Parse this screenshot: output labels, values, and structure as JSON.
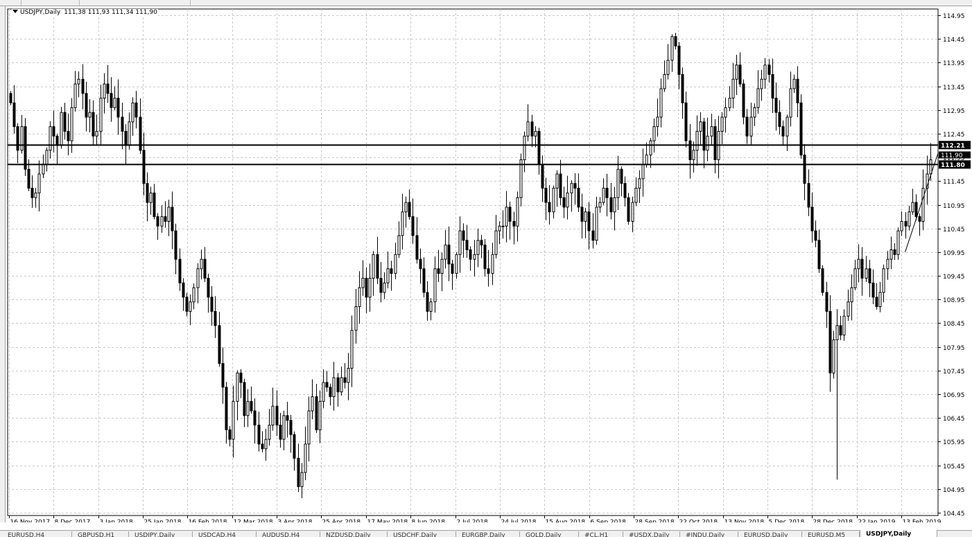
{
  "symbol": {
    "name": "USDJPY,Daily",
    "ohlc": "111,38 111,93 111,34 111,90"
  },
  "tabs": [
    {
      "label": "EURUSD,H4",
      "active": false
    },
    {
      "label": "GBPUSD,H1",
      "active": false
    },
    {
      "label": "USDJPY,Daily",
      "active": false
    },
    {
      "label": "USDCAD,H4",
      "active": false
    },
    {
      "label": "AUDUSD,H4",
      "active": false
    },
    {
      "label": "NZDUSD,Daily",
      "active": false
    },
    {
      "label": "USDCHF,Daily",
      "active": false
    },
    {
      "label": "EURGBP,Daily",
      "active": false
    },
    {
      "label": "GOLD,Daily",
      "active": false
    },
    {
      "label": "#CL,H1",
      "active": false
    },
    {
      "label": "#USDX,Daily",
      "active": false
    },
    {
      "label": "#INDU,Daily",
      "active": false
    },
    {
      "label": "EURUSD,Daily",
      "active": false
    },
    {
      "label": "EURUSD,M5",
      "active": false
    },
    {
      "label": "USDJPY,Daily",
      "active": true
    }
  ],
  "chart_data": {
    "type": "candlestick",
    "symbol": "USDJPY",
    "timeframe": "Daily",
    "y_ticks": [
      "114.95",
      "114.45",
      "113.95",
      "113.45",
      "112.95",
      "112.45",
      "111.95",
      "111.45",
      "110.95",
      "110.45",
      "109.95",
      "109.45",
      "108.95",
      "108.45",
      "107.95",
      "107.45",
      "106.95",
      "106.45",
      "105.95",
      "105.45",
      "104.95",
      "104.45"
    ],
    "ylim": [
      104.45,
      114.95
    ],
    "x_ticks": [
      "16 Nov 2017",
      "8 Dec 2017",
      "3 Jan 2018",
      "25 Jan 2018",
      "16 Feb 2018",
      "12 Mar 2018",
      "3 Apr 2018",
      "25 Apr 2018",
      "17 May 2018",
      "8 Jun 2018",
      "2 Jul 2018",
      "24 Jul 2018",
      "15 Aug 2018",
      "6 Sep 2018",
      "28 Sep 2018",
      "22 Oct 2018",
      "13 Nov 2018",
      "5 Dec 2018",
      "28 Dec 2018",
      "22 Jan 2019",
      "13 Feb 2019"
    ],
    "grid": true,
    "horizontal_lines": [
      {
        "value": 112.21,
        "label": "112.21"
      },
      {
        "value": 111.8,
        "label": "111.80"
      }
    ],
    "price_label": {
      "value": 111.9,
      "label": "111.90"
    },
    "trendline": {
      "from_date": "2019-01-03",
      "from_value": 109.95,
      "to_date": "2019-03-01",
      "to_value": 111.95
    },
    "closes": [
      113.1,
      112.6,
      112.1,
      112.6,
      111.7,
      111.3,
      111.1,
      111.2,
      111.6,
      111.8,
      112.1,
      112.6,
      112.4,
      112.2,
      112.9,
      112.5,
      112.3,
      113.0,
      113.5,
      113.6,
      113.3,
      112.8,
      112.9,
      112.4,
      112.5,
      113.2,
      113.5,
      113.3,
      113.0,
      113.2,
      112.8,
      112.5,
      112.2,
      112.7,
      113.1,
      112.8,
      112.1,
      111.4,
      111.0,
      111.2,
      110.7,
      110.5,
      110.7,
      110.6,
      110.9,
      110.4,
      109.8,
      109.3,
      109.0,
      108.7,
      108.9,
      109.2,
      109.6,
      109.8,
      109.4,
      109.0,
      108.7,
      108.4,
      107.6,
      107.1,
      106.2,
      106.0,
      106.8,
      107.4,
      107.2,
      106.5,
      106.8,
      106.6,
      106.3,
      105.9,
      105.8,
      106.0,
      106.3,
      106.7,
      106.3,
      106.0,
      106.5,
      106.4,
      106.1,
      105.6,
      105.0,
      105.3,
      105.9,
      106.6,
      106.9,
      106.2,
      106.8,
      107.2,
      107.1,
      106.9,
      107.3,
      107.0,
      107.3,
      107.2,
      107.5,
      108.3,
      108.8,
      109.2,
      109.4,
      109.0,
      109.4,
      109.9,
      109.4,
      109.1,
      109.3,
      109.6,
      109.5,
      109.9,
      110.3,
      110.8,
      111.0,
      110.7,
      110.3,
      109.8,
      109.6,
      109.1,
      108.7,
      108.9,
      109.6,
      109.5,
      109.8,
      110.1,
      109.7,
      109.5,
      109.9,
      110.4,
      110.2,
      110.0,
      109.8,
      109.9,
      110.2,
      110.1,
      109.6,
      109.5,
      109.9,
      110.4,
      110.5,
      110.5,
      110.9,
      110.6,
      110.5,
      111.1,
      111.9,
      112.4,
      112.7,
      112.4,
      112.5,
      111.8,
      111.3,
      111.0,
      110.8,
      111.3,
      111.6,
      111.1,
      110.9,
      111.2,
      111.4,
      111.3,
      110.9,
      110.6,
      110.8,
      110.4,
      110.2,
      110.9,
      111.0,
      111.3,
      111.1,
      110.8,
      111.1,
      111.7,
      111.4,
      111.1,
      110.6,
      111.0,
      111.3,
      111.5,
      111.8,
      112.0,
      112.3,
      112.6,
      112.8,
      113.4,
      113.7,
      114.0,
      114.5,
      114.3,
      113.7,
      113.1,
      112.3,
      111.9,
      112.1,
      112.5,
      112.7,
      112.1,
      112.4,
      112.6,
      111.9,
      112.5,
      112.8,
      113.0,
      113.2,
      113.6,
      113.9,
      113.5,
      112.8,
      112.4,
      112.8,
      113.0,
      113.4,
      113.6,
      113.9,
      113.7,
      113.2,
      112.9,
      112.6,
      112.4,
      112.8,
      113.4,
      113.6,
      113.1,
      112.0,
      111.4,
      110.9,
      110.4,
      110.2,
      109.6,
      109.1,
      108.7,
      107.4,
      108.1,
      108.4,
      108.2,
      108.6,
      108.9,
      109.2,
      109.6,
      109.8,
      109.4,
      109.6,
      109.3,
      109.0,
      108.8,
      109.1,
      109.6,
      109.8,
      110.0,
      109.9,
      110.4,
      110.6,
      110.5,
      110.8,
      111.0,
      110.7,
      110.6,
      111.3,
      111.6,
      111.9
    ]
  }
}
